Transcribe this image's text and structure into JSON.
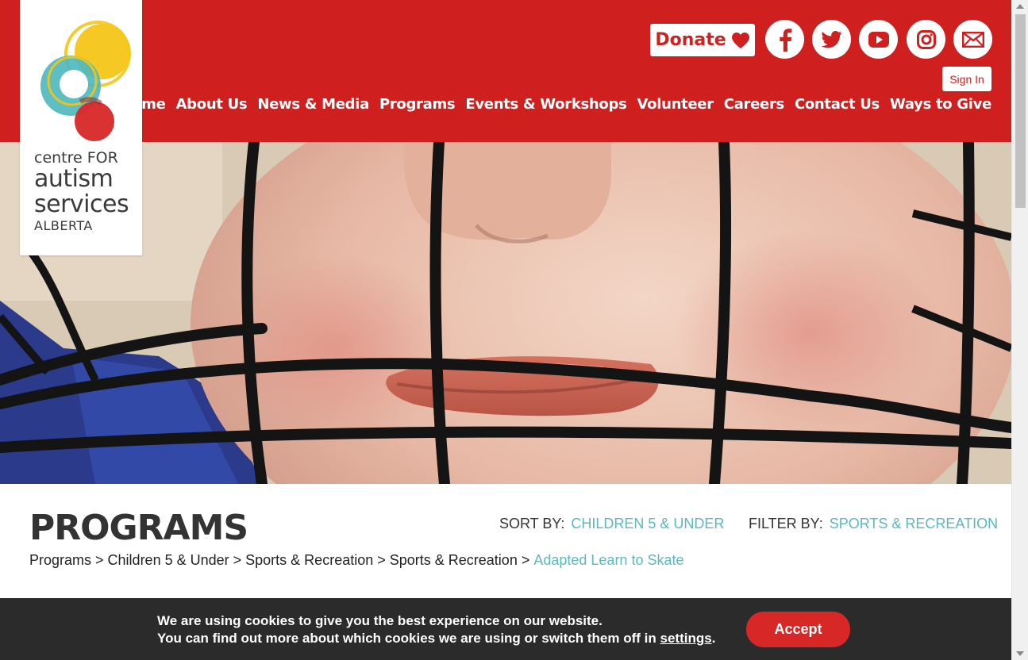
{
  "brand": {
    "name_line1": "centre FOR",
    "name_line2": "autism",
    "name_line3": "services",
    "name_line4": "ALBERTA",
    "colors": {
      "primary_red": "#d01f1f",
      "teal": "#5bb8bf",
      "yellow": "#f5c518"
    }
  },
  "header": {
    "donate_label": "Donate",
    "donate_icon": "heart-icon",
    "social": [
      "facebook-icon",
      "twitter-icon",
      "youtube-icon",
      "instagram-icon",
      "email-icon"
    ],
    "signin_label": "Sign In",
    "nav": [
      "Home",
      "About Us",
      "News & Media",
      "Programs",
      "Events & Workshops",
      "Volunteer",
      "Careers",
      "Contact Us",
      "Ways to Give"
    ]
  },
  "content": {
    "title": "PROGRAMS",
    "sort_label": "SORT BY:",
    "sort_value": "CHILDREN 5 & UNDER",
    "filter_label": "FILTER BY:",
    "filter_value": "SPORTS & RECREATION",
    "breadcrumb": [
      "Programs",
      "Children 5 & Under",
      "Sports & Recreation",
      "Sports & Recreation",
      "Adapted Learn to Skate"
    ],
    "breadcrumb_separator": ">"
  },
  "cookie": {
    "line1": "We are using cookies to give you the best experience on our website.",
    "line2_prefix": "You can find out more about which cookies we are using or switch them off in",
    "line2_link": "settings",
    "line2_suffix": ".",
    "accept_label": "Accept"
  }
}
